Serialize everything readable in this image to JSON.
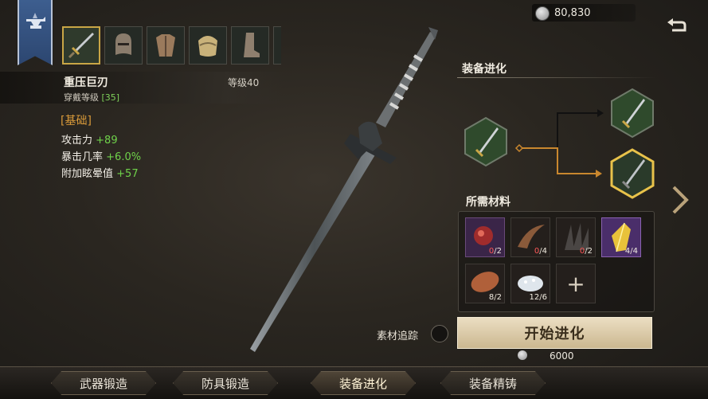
{
  "currency": {
    "amount": "80,830"
  },
  "item": {
    "name": "重压巨刃",
    "level": "等级40",
    "wear_label": "穿戴等级",
    "wear_value": "[35]"
  },
  "stats": {
    "title": "[基础]",
    "rows": [
      {
        "label": "攻击力",
        "value": "+89"
      },
      {
        "label": "暴击几率",
        "value": "+6.0%"
      },
      {
        "label": "附加眩晕值",
        "value": "+57"
      }
    ]
  },
  "item_slots": [
    "sword",
    "helmet",
    "chest-armor",
    "pauldron",
    "boots"
  ],
  "evolution": {
    "title": "装备进化"
  },
  "materials": {
    "title": "所需材料",
    "items": [
      {
        "name": "red-heart",
        "have": "0",
        "need": "2",
        "ok": false
      },
      {
        "name": "claw",
        "have": "0",
        "need": "4",
        "ok": false
      },
      {
        "name": "dark-spikes",
        "have": "0",
        "need": "2",
        "ok": false
      },
      {
        "name": "yellow-crystal",
        "have": "4",
        "need": "4",
        "ok": true
      },
      {
        "name": "fur-pelt",
        "have": "8",
        "need": "2",
        "ok": true
      },
      {
        "name": "white-salt",
        "have": "12",
        "need": "6",
        "ok": true
      }
    ],
    "add": "+"
  },
  "tracking": {
    "label": "素材追踪"
  },
  "start": {
    "label": "开始进化",
    "cost": "6000"
  },
  "tabs": [
    {
      "label": "武器锻造"
    },
    {
      "label": "防具锻造"
    },
    {
      "label": "装备进化"
    },
    {
      "label": "装备精铸"
    }
  ],
  "colors": {
    "insufficient": "#ff5959",
    "stat_value": "#6fd24a",
    "accent": "#c9a646"
  }
}
